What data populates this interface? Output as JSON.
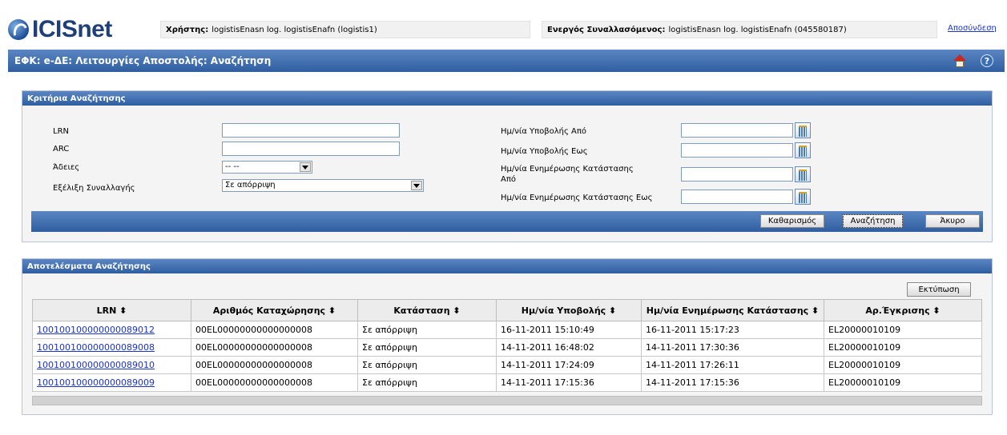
{
  "app": {
    "logo_text": "ICISnet",
    "logout": "Αποσύνδεση"
  },
  "user": {
    "label": "Χρήστης:",
    "value": "logistisEnasn log. logistisEnafn (logistis1)",
    "trader_label": "Ενεργός Συναλλασόμενος:",
    "trader_value": "logistisEnasn log. logistisEnafn (045580187)"
  },
  "page": {
    "title": "ΕΦΚ: e-ΔΕ: Λειτουργίες Αποστολής: Αναζήτηση"
  },
  "icons": {
    "home": "home-icon",
    "help": "help-icon",
    "calendar": "calendar-icon"
  },
  "colors": {
    "header": "#2f5e9f",
    "header_light": "#5b86c3",
    "link": "#1a33cc"
  },
  "criteria": {
    "title": "Κριτήρια Αναζήτησης",
    "lrn_label": "LRN",
    "lrn_value": "",
    "arc_label": "ARC",
    "arc_value": "",
    "permits_label": "Άδειες",
    "permits_value": "-- --",
    "progress_label": "Εξέλιξη Συναλλαγής",
    "progress_value": "Σε απόρριψη",
    "sub_from_label": "Ημ/νία Υποβολής Από",
    "sub_to_label": "Ημ/νία Υποβολής Εως",
    "upd_from_label_1": "Ημ/νία Ενημέρωσης Κατάστασης",
    "upd_from_label_2": "Από",
    "upd_to_label": "Ημ/νία Ενημέρωσης Κατάστασης Εως",
    "btn_clear": "Καθαρισμός",
    "btn_search": "Αναζήτηση",
    "btn_cancel": "Άκυρο"
  },
  "results": {
    "title": "Αποτελέσματα Αναζήτησης",
    "print": "Εκτύπωση",
    "columns": [
      "LRN ⬍",
      "Αριθμός Καταχώρησης ⬍",
      "Κατάσταση ⬍",
      "Ημ/νία Υποβολής ⬍",
      "Ημ/νία Ενημέρωσης Κατάστασης ⬍",
      "Αρ.Έγκρισης ⬍"
    ],
    "rows": [
      [
        "100100100000000089012",
        "00EL00000000000000008",
        "Σε απόρριψη",
        "16-11-2011 15:10:49",
        "16-11-2011 15:17:23",
        "EL20000010109"
      ],
      [
        "100100100000000089008",
        "00EL00000000000000008",
        "Σε απόρριψη",
        "14-11-2011 16:48:02",
        "14-11-2011 17:30:36",
        "EL20000010109"
      ],
      [
        "100100100000000089010",
        "00EL00000000000000008",
        "Σε απόρριψη",
        "14-11-2011 17:24:09",
        "14-11-2011 17:26:11",
        "EL20000010109"
      ],
      [
        "100100100000000089009",
        "00EL00000000000000008",
        "Σε απόρριψη",
        "14-11-2011 17:15:36",
        "14-11-2011 17:15:36",
        "EL20000010109"
      ]
    ]
  }
}
